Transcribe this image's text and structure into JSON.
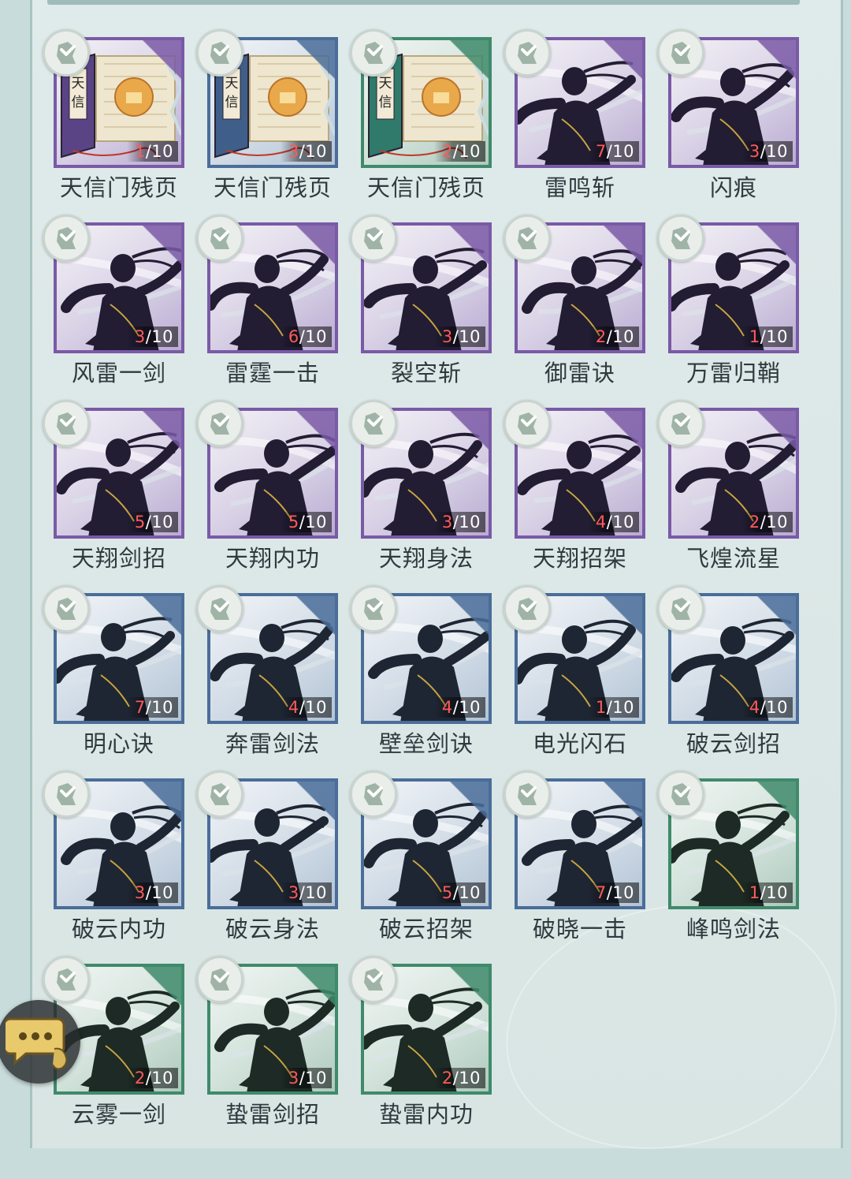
{
  "accent_colors": {
    "purple": "#7a5aa6",
    "blue": "#4a6d99",
    "green": "#3f8a6b",
    "owned_count": "#ff5a5a"
  },
  "items": [
    {
      "name": "天信门残页",
      "owned": "1",
      "max": "/10",
      "rarity": "purple",
      "art": "scroll"
    },
    {
      "name": "天信门残页",
      "owned": "3",
      "max": "/10",
      "rarity": "blue",
      "art": "scroll"
    },
    {
      "name": "天信门残页",
      "owned": "2",
      "max": "/10",
      "rarity": "green",
      "art": "scroll"
    },
    {
      "name": "雷鸣斩",
      "owned": "7",
      "max": "/10",
      "rarity": "purple",
      "art": "figure"
    },
    {
      "name": "闪痕",
      "owned": "3",
      "max": "/10",
      "rarity": "purple",
      "art": "figure"
    },
    {
      "name": "风雷一剑",
      "owned": "3",
      "max": "/10",
      "rarity": "purple",
      "art": "figure"
    },
    {
      "name": "雷霆一击",
      "owned": "6",
      "max": "/10",
      "rarity": "purple",
      "art": "figure"
    },
    {
      "name": "裂空斩",
      "owned": "3",
      "max": "/10",
      "rarity": "purple",
      "art": "figure"
    },
    {
      "name": "御雷诀",
      "owned": "2",
      "max": "/10",
      "rarity": "purple",
      "art": "figure"
    },
    {
      "name": "万雷归鞘",
      "owned": "1",
      "max": "/10",
      "rarity": "purple",
      "art": "figure"
    },
    {
      "name": "天翔剑招",
      "owned": "5",
      "max": "/10",
      "rarity": "purple",
      "art": "figure"
    },
    {
      "name": "天翔内功",
      "owned": "5",
      "max": "/10",
      "rarity": "purple",
      "art": "figure"
    },
    {
      "name": "天翔身法",
      "owned": "3",
      "max": "/10",
      "rarity": "purple",
      "art": "figure"
    },
    {
      "name": "天翔招架",
      "owned": "4",
      "max": "/10",
      "rarity": "purple",
      "art": "figure"
    },
    {
      "name": "飞煌流星",
      "owned": "2",
      "max": "/10",
      "rarity": "purple",
      "art": "figure"
    },
    {
      "name": "明心诀",
      "owned": "7",
      "max": "/10",
      "rarity": "blue",
      "art": "figure"
    },
    {
      "name": "奔雷剑法",
      "owned": "4",
      "max": "/10",
      "rarity": "blue",
      "art": "figure"
    },
    {
      "name": "壁垒剑诀",
      "owned": "4",
      "max": "/10",
      "rarity": "blue",
      "art": "figure"
    },
    {
      "name": "电光闪石",
      "owned": "1",
      "max": "/10",
      "rarity": "blue",
      "art": "figure"
    },
    {
      "name": "破云剑招",
      "owned": "4",
      "max": "/10",
      "rarity": "blue",
      "art": "figure"
    },
    {
      "name": "破云内功",
      "owned": "3",
      "max": "/10",
      "rarity": "blue",
      "art": "figure"
    },
    {
      "name": "破云身法",
      "owned": "3",
      "max": "/10",
      "rarity": "blue",
      "art": "figure"
    },
    {
      "name": "破云招架",
      "owned": "5",
      "max": "/10",
      "rarity": "blue",
      "art": "figure"
    },
    {
      "name": "破晓一击",
      "owned": "7",
      "max": "/10",
      "rarity": "blue",
      "art": "figure"
    },
    {
      "name": "峰鸣剑法",
      "owned": "1",
      "max": "/10",
      "rarity": "green",
      "art": "figure"
    },
    {
      "name": "云雾一剑",
      "owned": "2",
      "max": "/10",
      "rarity": "green",
      "art": "figure"
    },
    {
      "name": "蛰雷剑招",
      "owned": "3",
      "max": "/10",
      "rarity": "green",
      "art": "figure"
    },
    {
      "name": "蛰雷内功",
      "owned": "2",
      "max": "/10",
      "rarity": "green",
      "art": "figure"
    }
  ],
  "scroll_text": "天信",
  "chat_button": {
    "icon": "chat-bubble-icon"
  }
}
